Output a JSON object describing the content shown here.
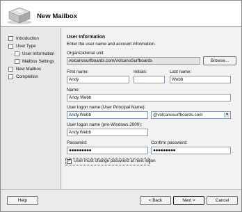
{
  "wizard": {
    "title": "New Mailbox"
  },
  "nav": {
    "items": [
      {
        "label": "Introduction"
      },
      {
        "label": "User Type"
      },
      {
        "label": "User Information"
      },
      {
        "label": "Mailbox Settings"
      },
      {
        "label": "New Mailbox"
      },
      {
        "label": "Completion"
      }
    ]
  },
  "page": {
    "heading": "User Information",
    "description": "Enter the user name and account information.",
    "org_unit_label": "Organizational unit:",
    "org_unit_value": "volcanosurfboards.com/VolcanoSurfboards",
    "browse_label": "Browse...",
    "first_name_label": "First name:",
    "first_name_value": "Andy",
    "initials_label": "Initials:",
    "initials_value": "",
    "last_name_label": "Last name:",
    "last_name_value": "Webb",
    "name_label": "Name:",
    "name_value": "Andy Webb",
    "upn_label": "User logon name (User Principal Name):",
    "upn_value": "Andy.Webb",
    "domain_value": "@volcanosurfboards.com",
    "pre2000_label": "User logon name (pre-Windows 2000):",
    "pre2000_value": "Andy.Webb",
    "password_label": "Password:",
    "password_value": "●●●●●●●●●",
    "confirm_label": "Confirm password:",
    "confirm_value": "●●●●●●●●●",
    "must_change_label": "User must change password at next logon",
    "must_change_checked": true
  },
  "footer": {
    "help_label": "Help",
    "back_label": "< Back",
    "next_label": "Next >",
    "cancel_label": "Cancel"
  }
}
